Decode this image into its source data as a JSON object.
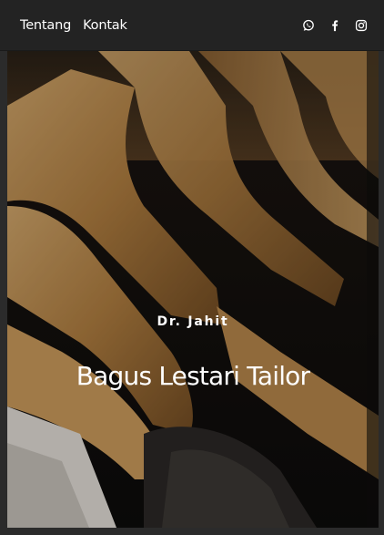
{
  "nav": {
    "links": [
      {
        "label": "Tentang"
      },
      {
        "label": "Kontak"
      }
    ],
    "icons": [
      "whatsapp-icon",
      "facebook-icon",
      "instagram-icon"
    ]
  },
  "hero": {
    "subtitle": "Dr. Jahit",
    "title": "Bagus Lestari Tailor"
  },
  "colors": {
    "navbar_bg": "#232323",
    "page_bg": "#2b2b2b",
    "text": "#ffffff"
  }
}
